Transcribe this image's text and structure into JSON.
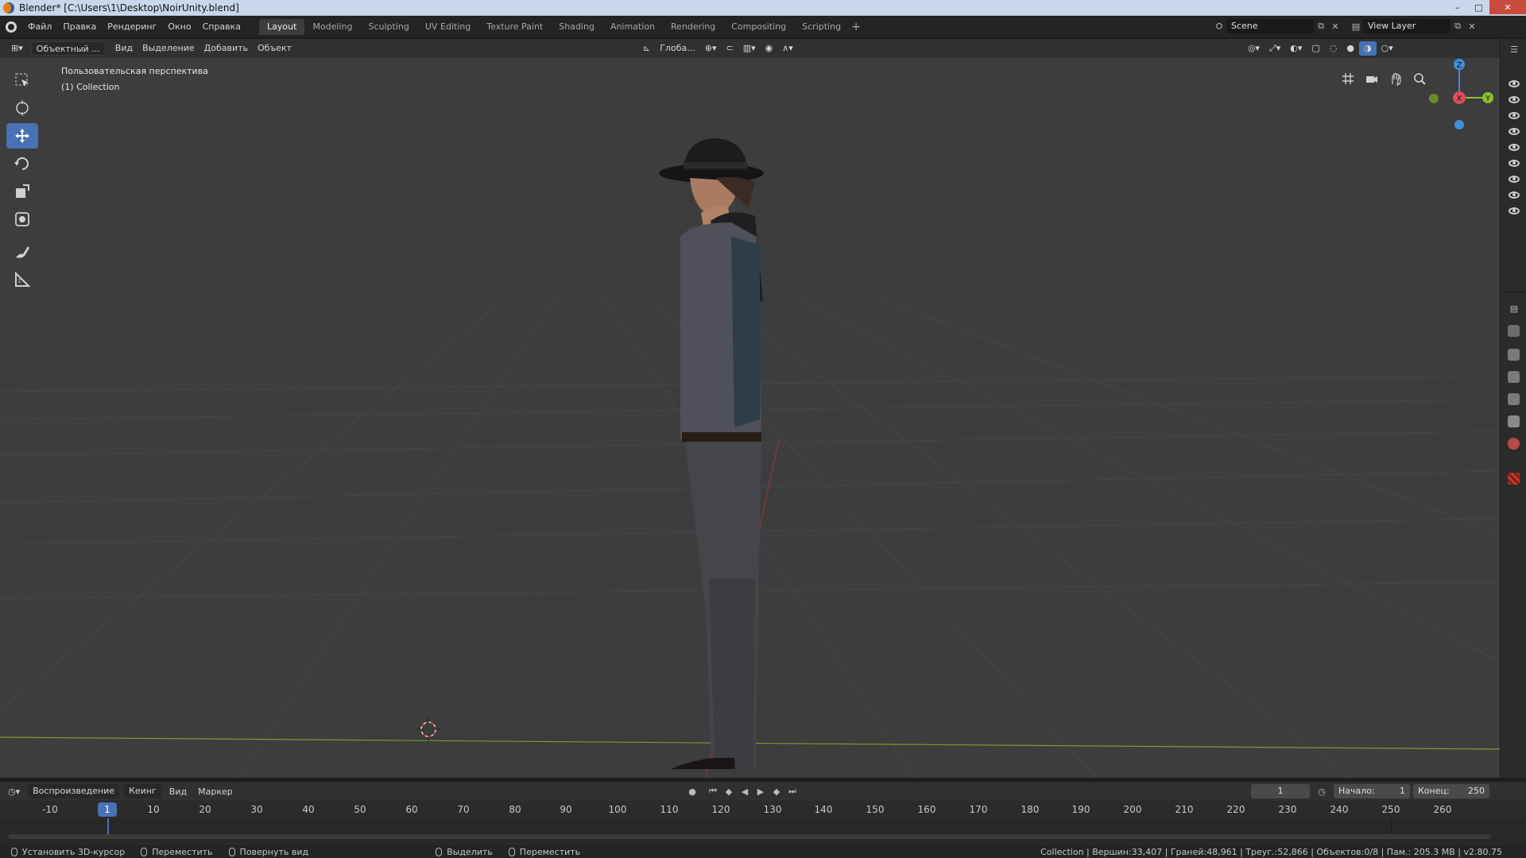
{
  "window": {
    "title": "Blender* [C:\\Users\\1\\Desktop\\NoirUnity.blend]",
    "controls": [
      "–",
      "□",
      "✕"
    ]
  },
  "topbar": {
    "menus": [
      "Файл",
      "Правка",
      "Рендеринг",
      "Окно",
      "Справка"
    ],
    "workspaces": [
      "Layout",
      "Modeling",
      "Sculpting",
      "UV Editing",
      "Texture Paint",
      "Shading",
      "Animation",
      "Rendering",
      "Compositing",
      "Scripting"
    ],
    "active_workspace": "Layout",
    "scene": "Scene",
    "view_layer": "View Layer"
  },
  "viewport_header": {
    "mode": "Объектный ...",
    "menus": [
      "Вид",
      "Выделение",
      "Добавить",
      "Объект"
    ],
    "transform_orientation": "Глоба..."
  },
  "viewport": {
    "perspective_label": "Пользовательская перспектива",
    "collection_label": "(1) Collection",
    "gizmo_axes": [
      "Z",
      "X",
      "Y"
    ]
  },
  "toolbar": {
    "tools": [
      "select-box",
      "cursor",
      "move",
      "rotate",
      "scale",
      "transform",
      "annotate",
      "measure"
    ],
    "active_tool": "move"
  },
  "timeline": {
    "menus": [
      "Воспроизведение",
      "Кеинг",
      "Вид",
      "Маркер"
    ],
    "current_frame": "1",
    "start_label": "Начало:",
    "start": "1",
    "end_label": "Конец:",
    "end": "250",
    "ticks": [
      "-10",
      "1",
      "10",
      "20",
      "30",
      "40",
      "50",
      "60",
      "70",
      "80",
      "90",
      "100",
      "110",
      "120",
      "130",
      "140",
      "150",
      "160",
      "170",
      "180",
      "190",
      "200",
      "210",
      "220",
      "230",
      "240",
      "250",
      "260"
    ]
  },
  "statusbar": {
    "left": [
      "Установить 3D-курсор",
      "Переместить",
      "Повернуть вид"
    ],
    "middle": [
      "Выделить",
      "Переместить"
    ],
    "stats": "Collection | Вершин:33,407 | Граней:48,961 | Треуг.:52,866 | Объектов:0/8 | Пам.: 205.3 MB | v2.80.75"
  },
  "colors": {
    "accent": "#4772b3",
    "viewport_bg": "#3d3d3d",
    "x_axis": "#e04a5c",
    "y_axis": "#8bbf2c",
    "z_axis": "#3f8fdd"
  }
}
